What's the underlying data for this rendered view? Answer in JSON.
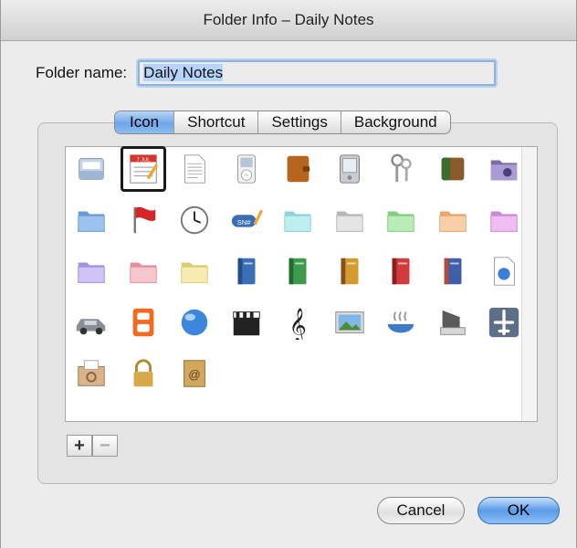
{
  "window": {
    "title": "Folder Info – Daily Notes"
  },
  "folder_name": {
    "label": "Folder name:",
    "value": "Daily Notes"
  },
  "tabs": [
    {
      "label": "Icon",
      "active": true
    },
    {
      "label": "Shortcut",
      "active": false
    },
    {
      "label": "Settings",
      "active": false
    },
    {
      "label": "Background",
      "active": false
    }
  ],
  "icons": [
    {
      "name": "inbox-tray-icon",
      "selected": false
    },
    {
      "name": "calendar-notepad-icon",
      "selected": true,
      "date_text": "7 JUL"
    },
    {
      "name": "text-document-icon",
      "selected": false
    },
    {
      "name": "ipod-icon",
      "selected": false
    },
    {
      "name": "leather-organizer-icon",
      "selected": false
    },
    {
      "name": "pda-icon",
      "selected": false
    },
    {
      "name": "keys-icon",
      "selected": false
    },
    {
      "name": "wallet-icon",
      "selected": false
    },
    {
      "name": "purple-gear-folder-icon",
      "selected": false
    },
    {
      "name": "blue-folder-icon",
      "selected": false
    },
    {
      "name": "red-flag-icon",
      "selected": false
    },
    {
      "name": "clock-icon",
      "selected": false
    },
    {
      "name": "sn-pencil-icon",
      "selected": false,
      "text": "SN#"
    },
    {
      "name": "cyan-folder-icon",
      "selected": false
    },
    {
      "name": "gray-folder-icon",
      "selected": false
    },
    {
      "name": "green-folder-icon",
      "selected": false
    },
    {
      "name": "orange-folder-icon",
      "selected": false
    },
    {
      "name": "magenta-folder-icon",
      "selected": false
    },
    {
      "name": "lavender-folder-icon",
      "selected": false
    },
    {
      "name": "pink-folder-icon",
      "selected": false
    },
    {
      "name": "yellow-folder-icon",
      "selected": false
    },
    {
      "name": "blue-book-icon",
      "selected": false
    },
    {
      "name": "green-book-icon",
      "selected": false
    },
    {
      "name": "orange-book-icon",
      "selected": false
    },
    {
      "name": "red-book-icon",
      "selected": false
    },
    {
      "name": "navy-book-icon",
      "selected": false
    },
    {
      "name": "globe-document-icon",
      "selected": false
    },
    {
      "name": "car-icon",
      "selected": false
    },
    {
      "name": "digital-eight-icon",
      "selected": false
    },
    {
      "name": "blue-globe-icon",
      "selected": false
    },
    {
      "name": "clapperboard-icon",
      "selected": false
    },
    {
      "name": "treble-clef-icon",
      "selected": false
    },
    {
      "name": "landscape-picture-icon",
      "selected": false
    },
    {
      "name": "steaming-bowl-icon",
      "selected": false
    },
    {
      "name": "network-drive-icon",
      "selected": false
    },
    {
      "name": "airplane-icon",
      "selected": false
    },
    {
      "name": "mail-recycle-box-icon",
      "selected": false
    },
    {
      "name": "padlock-icon",
      "selected": false
    },
    {
      "name": "address-book-icon",
      "selected": false
    }
  ],
  "icon_list_controls": {
    "add": "+",
    "remove": "−"
  },
  "buttons": {
    "cancel": "Cancel",
    "ok": "OK"
  },
  "colors": {
    "accent": "#6fa6ea",
    "selection": "#b6d4fb"
  }
}
